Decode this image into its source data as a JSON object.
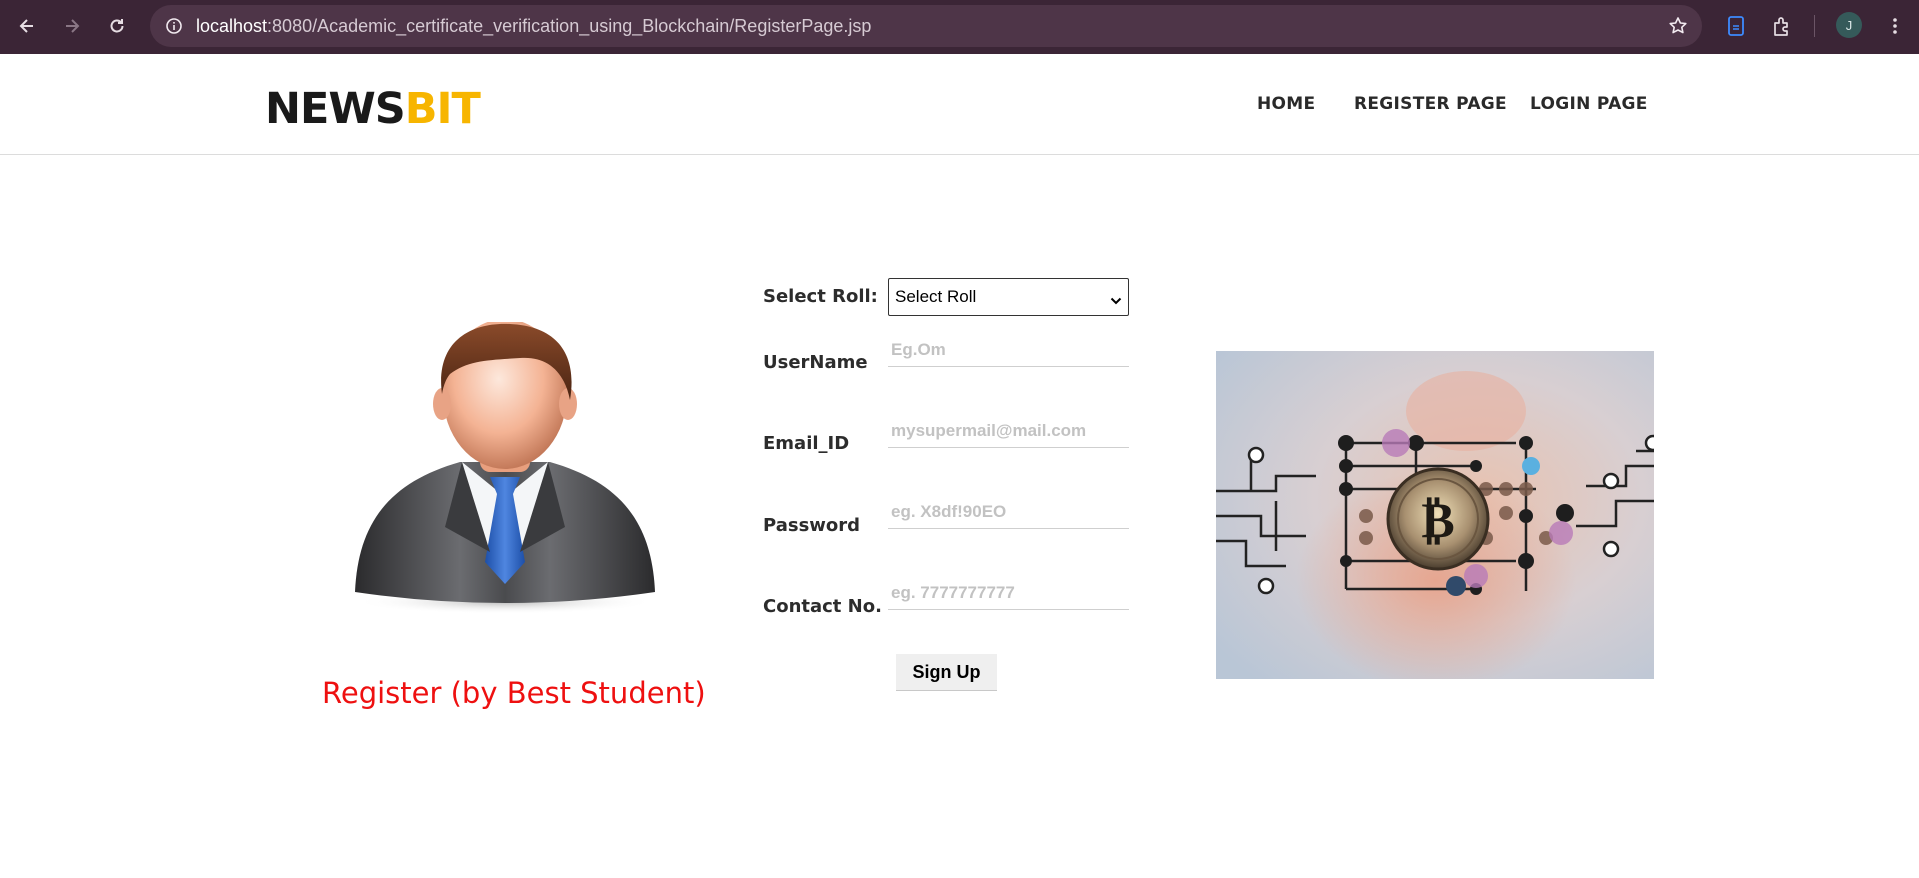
{
  "browser": {
    "url_host": "localhost",
    "url_path": ":8080/Academic_certificate_verification_using_Blockchain/RegisterPage.jsp",
    "profile_initial": "J",
    "icons": [
      "back-icon",
      "forward-icon",
      "reload-icon",
      "info-icon",
      "star-icon",
      "document-icon",
      "extensions-icon",
      "menu-dots-icon"
    ]
  },
  "header": {
    "logo_part1": "NEWS",
    "logo_part2": "BIT",
    "nav": [
      "HOME",
      "REGISTER PAGE",
      "LOGIN PAGE"
    ],
    "colors": {
      "logo_accent": "#f7b500",
      "logo_dark": "#1a1a1a"
    }
  },
  "left": {
    "caption": "Register (by Best Student)",
    "caption_color": "#ee1010"
  },
  "form": {
    "roll_label": "Select Roll:",
    "roll_selected": "Select Roll",
    "username_label": "UserName",
    "username_placeholder": "Eg.Om",
    "email_label": "Email_ID",
    "email_placeholder": "mysupermail@mail.com",
    "password_label": "Password",
    "password_placeholder": "eg. X8df!90EO",
    "contact_label": "Contact No.",
    "contact_placeholder": "eg. 7777777777",
    "submit_label": "Sign Up"
  }
}
